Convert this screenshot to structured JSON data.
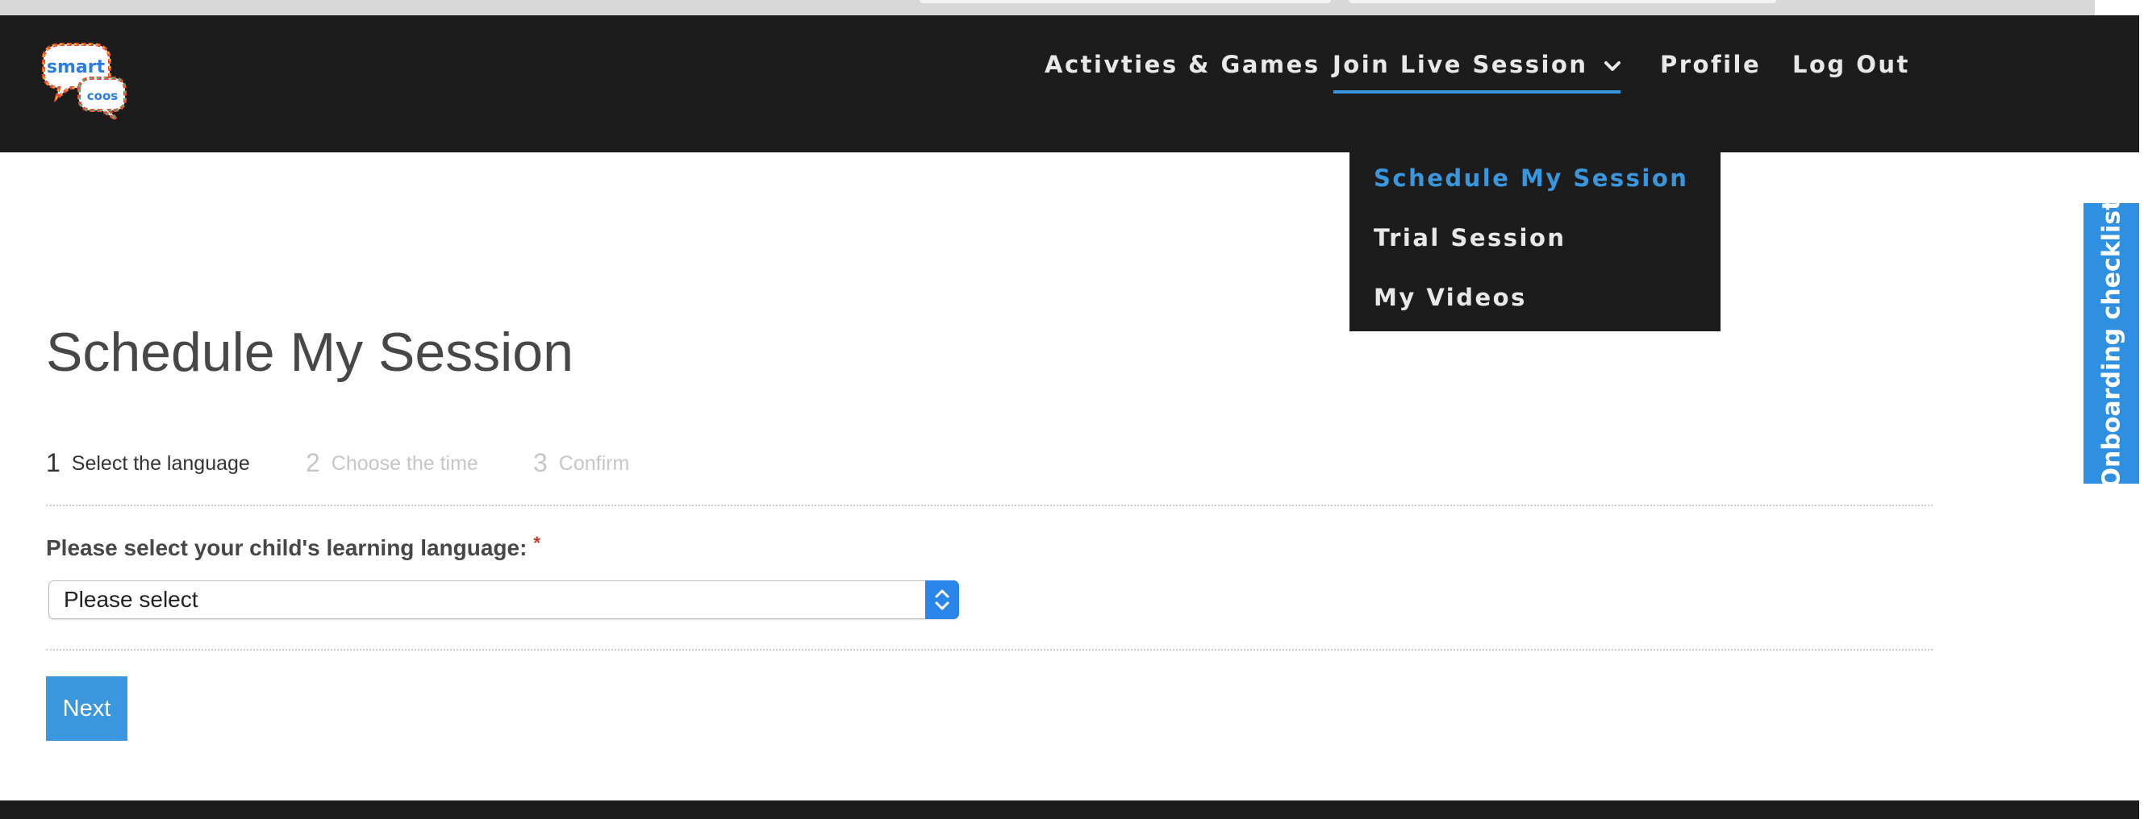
{
  "brand": {
    "logo_line1": "smart",
    "logo_line2": "coos"
  },
  "nav": {
    "items": [
      {
        "label": "Activties & Games"
      },
      {
        "label": "Join Live Session"
      },
      {
        "label": "Profile"
      },
      {
        "label": "Log Out"
      }
    ],
    "active_index": 1,
    "dropdown": [
      {
        "label": "Schedule My Session",
        "active": true
      },
      {
        "label": "Trial Session"
      },
      {
        "label": "My Videos"
      }
    ]
  },
  "page": {
    "title": "Schedule My Session",
    "steps": [
      {
        "number": "1",
        "label": "Select the language",
        "state": "current"
      },
      {
        "number": "2",
        "label": "Choose the time",
        "state": "upcoming"
      },
      {
        "number": "3",
        "label": "Confirm",
        "state": "upcoming"
      }
    ],
    "form": {
      "language_label": "Please select your child's learning language:",
      "required_mark": "*",
      "language_select_value": "Please select",
      "next_label": "Next"
    }
  },
  "onboarding": {
    "label": "Onboarding checklist"
  },
  "colors": {
    "header_bg": "#1c1c1c",
    "accent": "#3a97dd",
    "onboarding_bg": "#2f8fe0",
    "select_arrow_bg": "#2a85e8",
    "required": "#c0392b"
  },
  "icons": {
    "nav_dropdown": "chevron-down-icon",
    "select_arrows": "up-down-chevron-icon"
  }
}
